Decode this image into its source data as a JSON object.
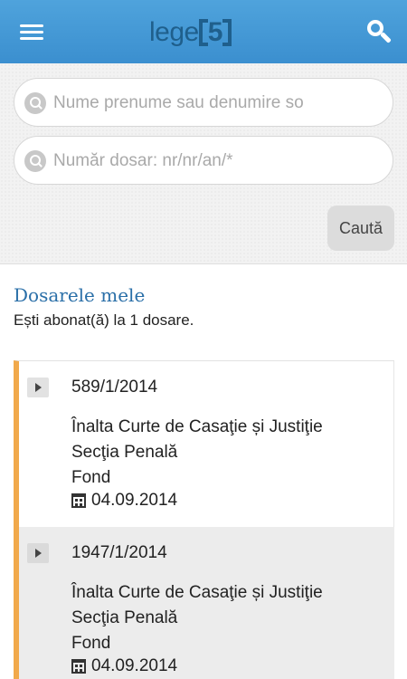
{
  "header": {
    "logo_text": "lege",
    "logo_number": "5",
    "menu_icon": "hamburger-menu-icon",
    "search_icon": "search-icon"
  },
  "search": {
    "name_placeholder": "Nume prenume sau denumire so",
    "case_placeholder": "Număr dosar: nr/nr/an/*",
    "submit_label": "Caută"
  },
  "section": {
    "title": "Dosarele mele",
    "subtitle": "Ești abonat(ă) la 1 dosare."
  },
  "cases": [
    {
      "number": "589/1/2014",
      "court": "Înalta Curte de Casaţie și Justiţie",
      "section": "Secţia Penală",
      "stage": "Fond",
      "date": "04.09.2014"
    },
    {
      "number": "1947/1/2014",
      "court": "Înalta Curte de Casaţie și Justiţie",
      "section": "Secţia Penală",
      "stage": "Fond",
      "date": "04.09.2014"
    }
  ],
  "colors": {
    "header": "#3f95d4",
    "accent_border": "#f1a94b",
    "title": "#2a6fa8"
  }
}
